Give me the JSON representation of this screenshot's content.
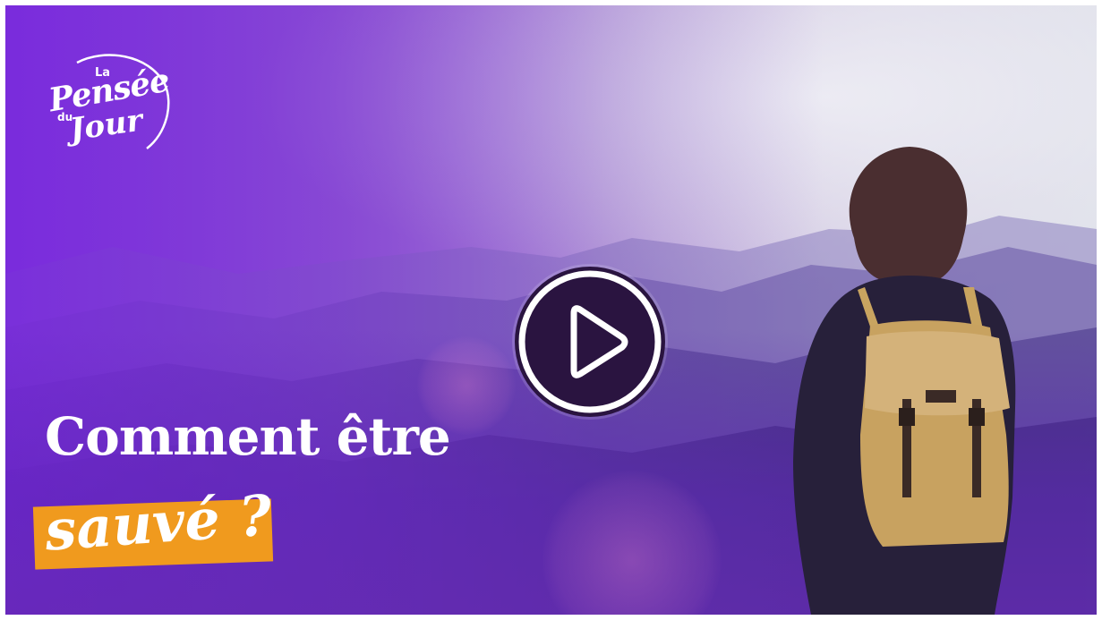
{
  "thumbnail": {
    "logo": {
      "la": "La",
      "pensee": "Pensée",
      "du": "du",
      "jour": "Jour"
    },
    "title": {
      "line1": "Comment être",
      "line2": "sauvé ?"
    },
    "play_button": {
      "icon": "play-icon"
    },
    "colors": {
      "accent_orange": "#f09a1e",
      "purple": "#7b32dd",
      "play_bg": "#2a1440"
    }
  }
}
